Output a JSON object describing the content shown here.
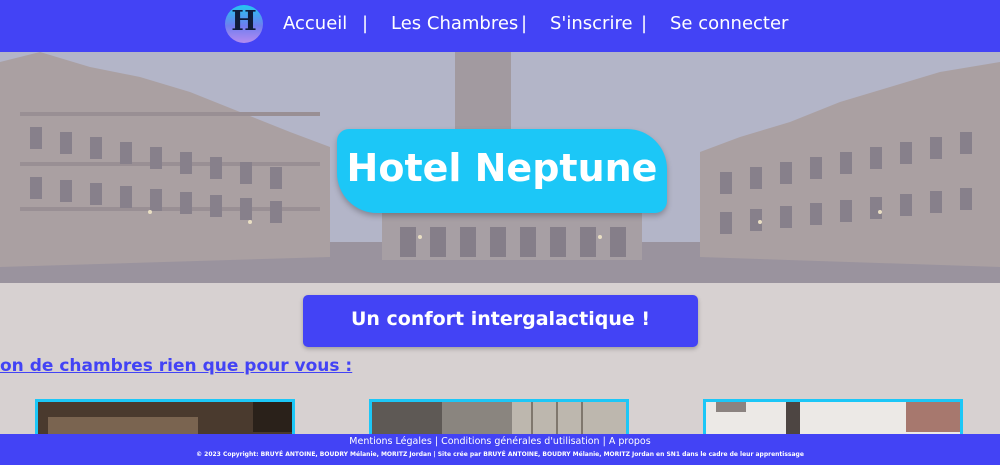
{
  "nav": {
    "logo_letter": "H",
    "items": [
      "Accueil",
      "Les Chambres",
      "S'inscrire",
      "Se connecter"
    ],
    "separator": "|"
  },
  "hero": {
    "title": "Hotel Neptune"
  },
  "tagline": "Un confort intergalactique !",
  "section_title": "on de chambres rien que pour vous :",
  "footer": {
    "links": [
      "Mentions Légales",
      "Conditions générales d'utilisation",
      "A propos"
    ],
    "link_separator": "|",
    "copyright": "© 2023 Copyright: BRUYÉ ANTOINE, BOUDRY Mélanie, MORITZ Jordan | Site crée par BRUYÉ ANTOINE, BOUDRY Mélanie, MORITZ Jordan en SN1 dans le cadre de leur apprentissage"
  },
  "colors": {
    "primary": "#4343f5",
    "accent": "#1cc7f7",
    "background": "#d7d1d1"
  }
}
